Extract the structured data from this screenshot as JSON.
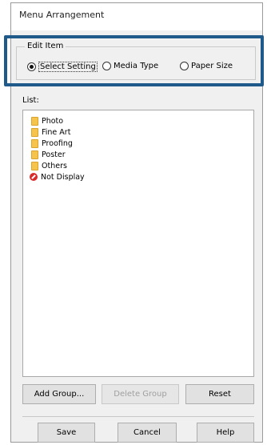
{
  "dialog": {
    "title": "Menu Arrangement"
  },
  "edit_item": {
    "legend": "Edit Item",
    "options": [
      {
        "label": "Select Setting",
        "selected": true
      },
      {
        "label": "Media Type",
        "selected": false
      },
      {
        "label": "Paper Size",
        "selected": false
      }
    ]
  },
  "list": {
    "label": "List:",
    "items": [
      {
        "label": "Photo",
        "icon": "folder-icon"
      },
      {
        "label": "Fine Art",
        "icon": "folder-icon"
      },
      {
        "label": "Proofing",
        "icon": "folder-icon"
      },
      {
        "label": "Poster",
        "icon": "folder-icon"
      },
      {
        "label": "Others",
        "icon": "folder-icon"
      },
      {
        "label": "Not Display",
        "icon": "no-display-icon"
      }
    ]
  },
  "buttons": {
    "add_group": "Add Group...",
    "delete_group": "Delete Group",
    "reset": "Reset",
    "save": "Save",
    "cancel": "Cancel",
    "help": "Help"
  },
  "colors": {
    "highlight": "#1f5a8a",
    "folder": "#f6c44d",
    "no_display": "#d92b2b"
  }
}
